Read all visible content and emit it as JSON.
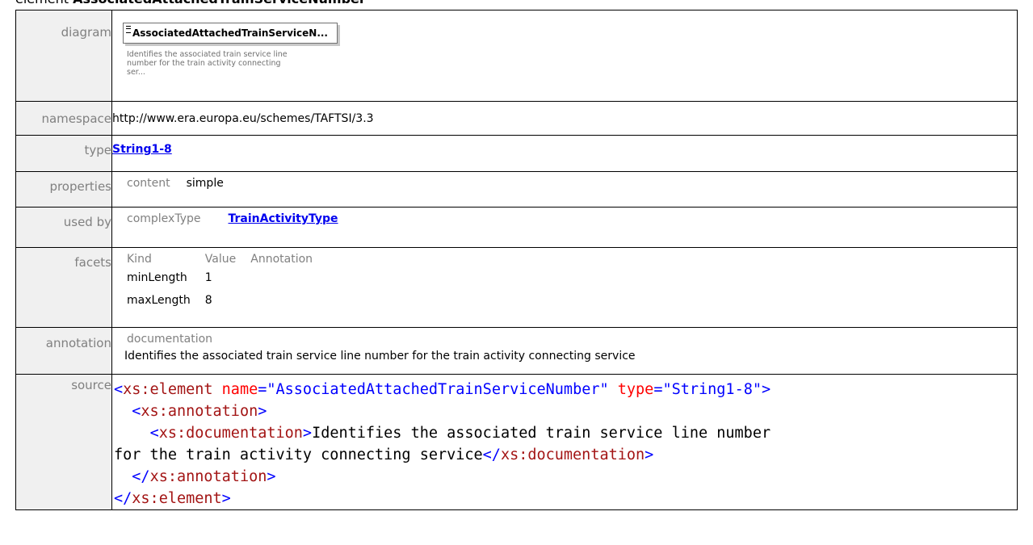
{
  "heading": {
    "prefix": "element",
    "name": "AssociatedAttachedTrainServiceNumber"
  },
  "rows": {
    "diagram": {
      "label": "diagram",
      "box_title": "AssociatedAttachedTrainServiceN...",
      "box_description": "Identifies the associated train service line number for the train activity connecting ser..."
    },
    "namespace": {
      "label": "namespace",
      "value": "http://www.era.europa.eu/schemes/TAFTSI/3.3"
    },
    "type": {
      "label": "type",
      "link": "String1-8"
    },
    "properties": {
      "label": "properties",
      "key": "content",
      "value": "simple"
    },
    "used_by": {
      "label": "used by",
      "key": "complexType",
      "link": "TrainActivityType"
    },
    "facets": {
      "label": "facets",
      "headers": [
        "Kind",
        "Value",
        "Annotation"
      ],
      "items": [
        {
          "kind": "minLength",
          "value": "1",
          "annotation": ""
        },
        {
          "kind": "maxLength",
          "value": "8",
          "annotation": ""
        }
      ]
    },
    "annotation": {
      "label": "annotation",
      "heading": "documentation",
      "text": "Identifies the associated train service line number for the train activity connecting service"
    },
    "source": {
      "label": "source",
      "element_open": "<",
      "tag_element": "xs:element",
      "attr_name": "name",
      "eq": "=",
      "attr_name_value": "\"AssociatedAttachedTrainServiceNumber\"",
      "attr_type": "type",
      "attr_type_value": "\"String1-8\"",
      "close_bracket": ">",
      "tag_annotation": "xs:annotation",
      "tag_documentation": "xs:documentation",
      "doc_text_1": "Identifies the associated train service line number",
      "doc_text_2": "for the train activity connecting service",
      "end_open": "</"
    }
  }
}
